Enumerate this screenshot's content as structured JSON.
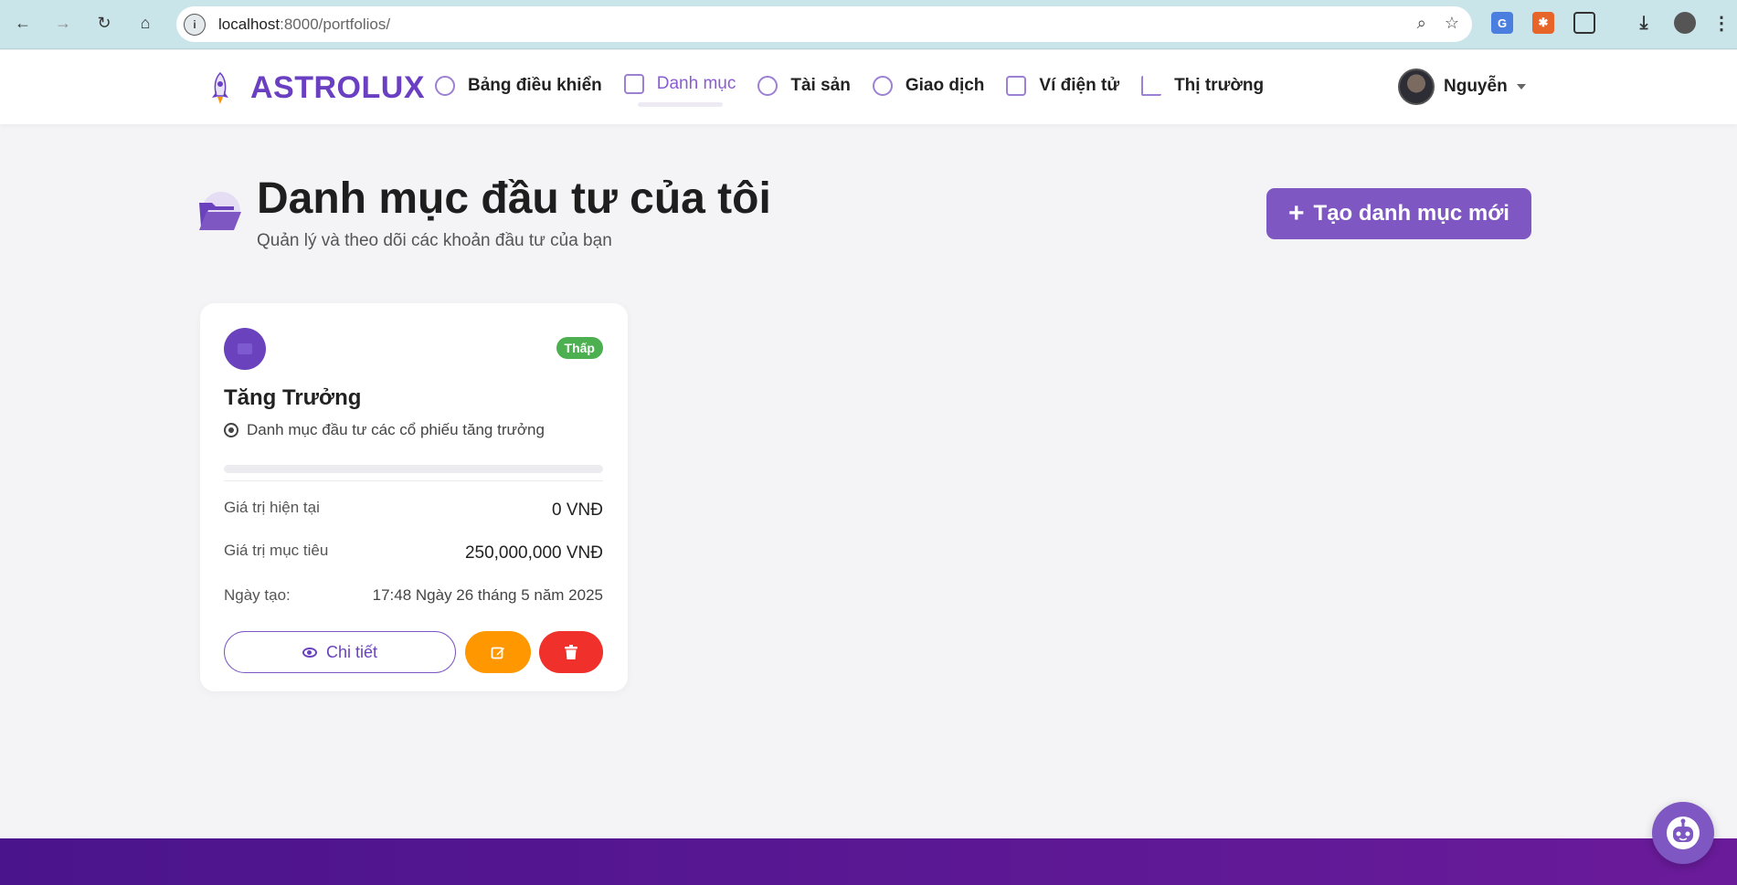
{
  "browser": {
    "url_host": "localhost",
    "url_rest": ":8000/portfolios/"
  },
  "brand": {
    "name": "ASTROLUX"
  },
  "nav": {
    "items": [
      {
        "label": "Bảng điều khiển",
        "icon": "dashboard-icon"
      },
      {
        "label": "Danh mục",
        "icon": "portfolio-icon"
      },
      {
        "label": "Tài sản",
        "icon": "money-bag-icon"
      },
      {
        "label": "Giao dịch",
        "icon": "coin-icon"
      },
      {
        "label": "Ví điện tử",
        "icon": "wallet-icon"
      },
      {
        "label": "Thị trường",
        "icon": "chart-icon"
      }
    ],
    "active": "Danh mục"
  },
  "user": {
    "name": "Nguyễn"
  },
  "header": {
    "title": "Danh mục đầu tư của tôi",
    "subtitle": "Quản lý và theo dõi các khoản đầu tư của bạn",
    "create_button": "Tạo danh mục mới"
  },
  "portfolio": {
    "name": "Tăng Trưởng",
    "risk": "Thấp",
    "risk_color": "#4caf50",
    "description": "Danh mục đầu tư các cổ phiếu tăng trưởng",
    "progress_fraction": 0,
    "current_label": "Giá trị hiện tại",
    "current_value": "0 VNĐ",
    "target_label": "Giá trị mục tiêu",
    "target_value": "250,000,000 VNĐ",
    "created_label": "Ngày tạo:",
    "created_value": "17:48 Ngày 26 tháng 5 năm 2025",
    "detail_button": "Chi tiết"
  },
  "colors": {
    "accent": "#7e57c2",
    "edit": "#ff9800",
    "delete": "#f0302a"
  }
}
